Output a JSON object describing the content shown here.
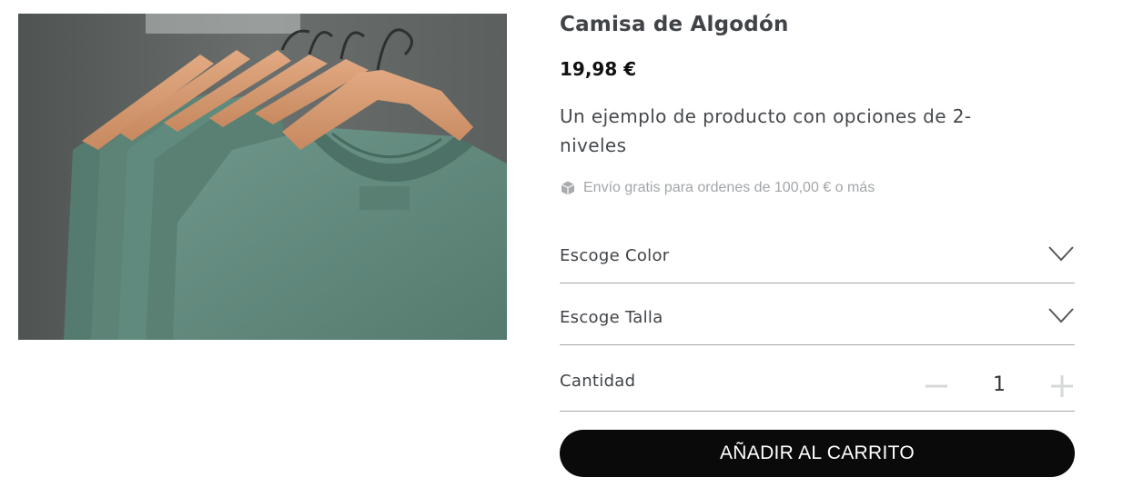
{
  "product": {
    "title": "Camisa de Algodón",
    "price": "19,98 €",
    "description": "Un ejemplo de producto con opciones de 2-niveles",
    "shipping_note": "Envío gratis para ordenes de 100,00 € o más",
    "shipping_icon": "package-icon"
  },
  "options": {
    "color_label": "Escoge Color",
    "size_label": "Escoge Talla",
    "chevron_icon": "chevron-down-icon"
  },
  "quantity": {
    "label": "Cantidad",
    "value": "1",
    "minus_icon": "minus-icon",
    "plus_icon": "plus-icon"
  },
  "cart": {
    "button_label": "AÑADIR AL CARRITO"
  },
  "colors": {
    "button_bg": "#0a0a0a",
    "divider": "#a4a6a8",
    "shirt_green": "#5f8579"
  }
}
